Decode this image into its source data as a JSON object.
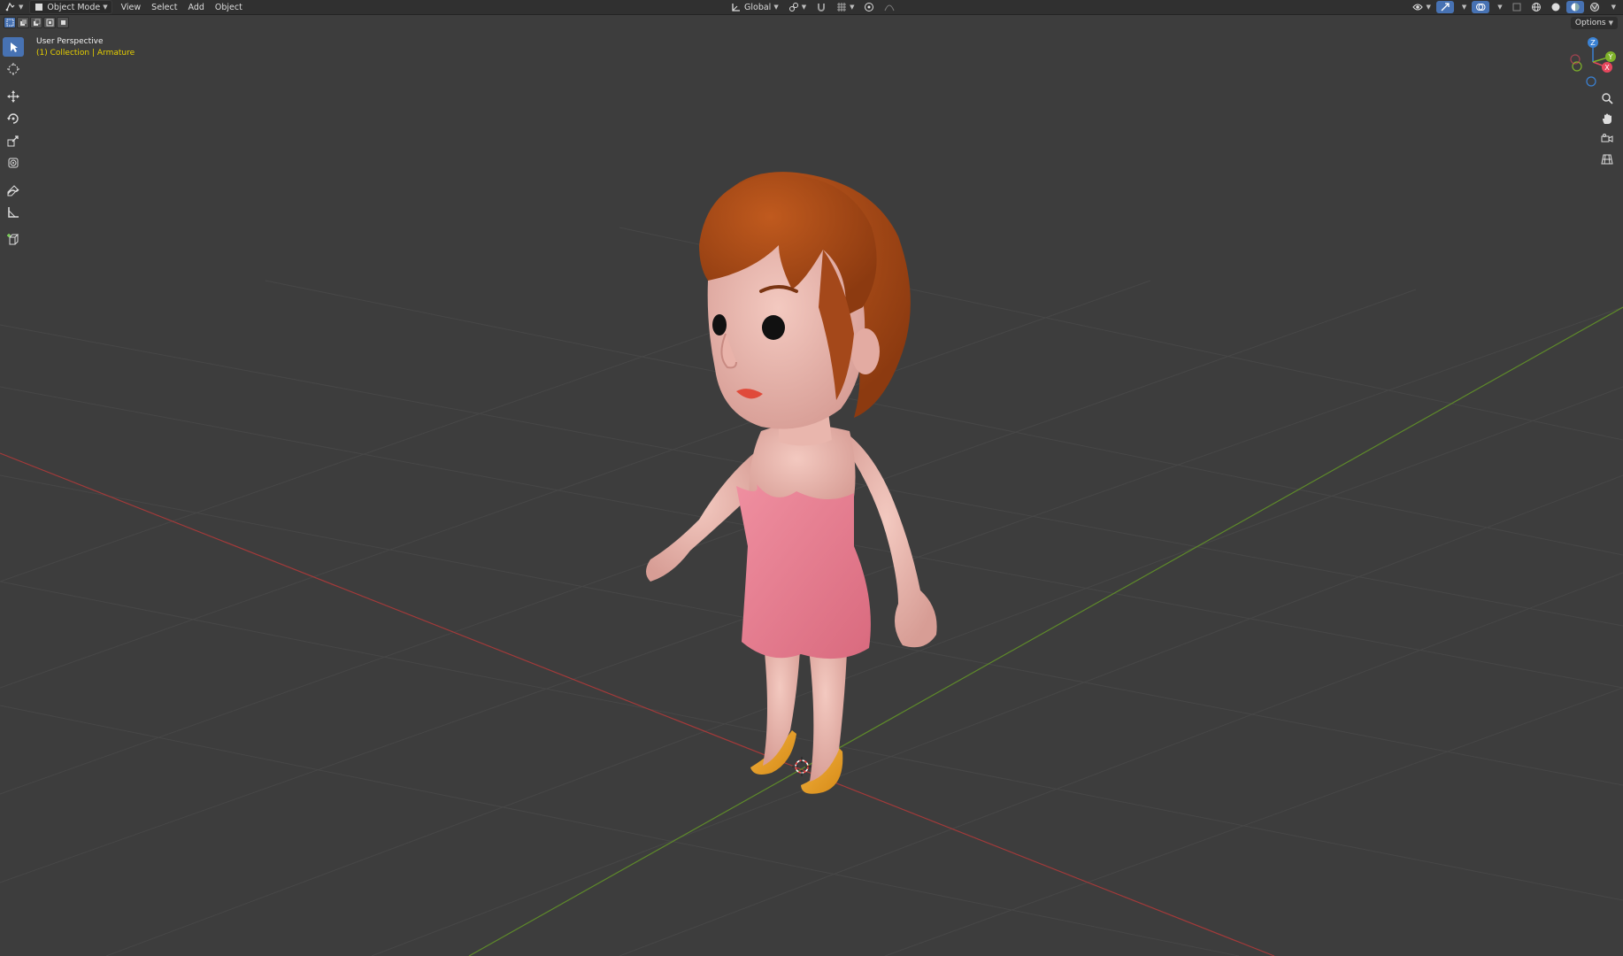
{
  "header": {
    "editor_type_icon": "editor-type-icon",
    "mode_label": "Object Mode",
    "menus": [
      "View",
      "Select",
      "Add",
      "Object"
    ],
    "transform_orientation": "Global"
  },
  "overlay": {
    "view_name": "User Perspective",
    "collection_info": "(1) Collection | Armature"
  },
  "options_label": "Options",
  "gizmo": {
    "axes": [
      "X",
      "Y",
      "Z"
    ],
    "colors": {
      "x": "#e5475d",
      "y": "#7fb22a",
      "z": "#3b82d4"
    }
  },
  "toolbar": {
    "tools": [
      "select-box",
      "cursor",
      "move",
      "rotate",
      "scale",
      "transform",
      "annotate",
      "measure",
      "add-cube"
    ]
  },
  "colors": {
    "viewport_bg": "#3d3d3d",
    "header_bg": "#303030",
    "accent": "#4772b3",
    "info_yellow": "#e6cf00",
    "x_axis_line": "#a33a3a",
    "y_axis_line": "#5e8a2a"
  }
}
